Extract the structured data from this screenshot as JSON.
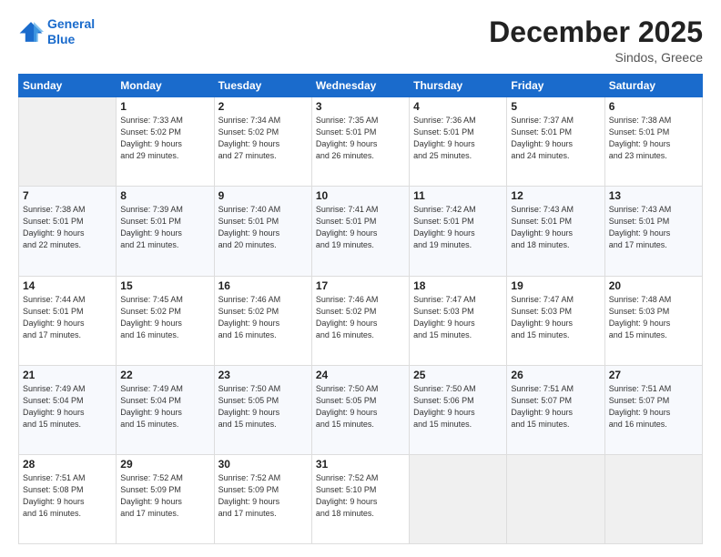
{
  "header": {
    "logo_line1": "General",
    "logo_line2": "Blue",
    "title": "December 2025",
    "subtitle": "Sindos, Greece"
  },
  "weekdays": [
    "Sunday",
    "Monday",
    "Tuesday",
    "Wednesday",
    "Thursday",
    "Friday",
    "Saturday"
  ],
  "weeks": [
    [
      {
        "day": "",
        "info": ""
      },
      {
        "day": "1",
        "info": "Sunrise: 7:33 AM\nSunset: 5:02 PM\nDaylight: 9 hours\nand 29 minutes."
      },
      {
        "day": "2",
        "info": "Sunrise: 7:34 AM\nSunset: 5:02 PM\nDaylight: 9 hours\nand 27 minutes."
      },
      {
        "day": "3",
        "info": "Sunrise: 7:35 AM\nSunset: 5:01 PM\nDaylight: 9 hours\nand 26 minutes."
      },
      {
        "day": "4",
        "info": "Sunrise: 7:36 AM\nSunset: 5:01 PM\nDaylight: 9 hours\nand 25 minutes."
      },
      {
        "day": "5",
        "info": "Sunrise: 7:37 AM\nSunset: 5:01 PM\nDaylight: 9 hours\nand 24 minutes."
      },
      {
        "day": "6",
        "info": "Sunrise: 7:38 AM\nSunset: 5:01 PM\nDaylight: 9 hours\nand 23 minutes."
      }
    ],
    [
      {
        "day": "7",
        "info": "Sunrise: 7:38 AM\nSunset: 5:01 PM\nDaylight: 9 hours\nand 22 minutes."
      },
      {
        "day": "8",
        "info": "Sunrise: 7:39 AM\nSunset: 5:01 PM\nDaylight: 9 hours\nand 21 minutes."
      },
      {
        "day": "9",
        "info": "Sunrise: 7:40 AM\nSunset: 5:01 PM\nDaylight: 9 hours\nand 20 minutes."
      },
      {
        "day": "10",
        "info": "Sunrise: 7:41 AM\nSunset: 5:01 PM\nDaylight: 9 hours\nand 19 minutes."
      },
      {
        "day": "11",
        "info": "Sunrise: 7:42 AM\nSunset: 5:01 PM\nDaylight: 9 hours\nand 19 minutes."
      },
      {
        "day": "12",
        "info": "Sunrise: 7:43 AM\nSunset: 5:01 PM\nDaylight: 9 hours\nand 18 minutes."
      },
      {
        "day": "13",
        "info": "Sunrise: 7:43 AM\nSunset: 5:01 PM\nDaylight: 9 hours\nand 17 minutes."
      }
    ],
    [
      {
        "day": "14",
        "info": "Sunrise: 7:44 AM\nSunset: 5:01 PM\nDaylight: 9 hours\nand 17 minutes."
      },
      {
        "day": "15",
        "info": "Sunrise: 7:45 AM\nSunset: 5:02 PM\nDaylight: 9 hours\nand 16 minutes."
      },
      {
        "day": "16",
        "info": "Sunrise: 7:46 AM\nSunset: 5:02 PM\nDaylight: 9 hours\nand 16 minutes."
      },
      {
        "day": "17",
        "info": "Sunrise: 7:46 AM\nSunset: 5:02 PM\nDaylight: 9 hours\nand 16 minutes."
      },
      {
        "day": "18",
        "info": "Sunrise: 7:47 AM\nSunset: 5:03 PM\nDaylight: 9 hours\nand 15 minutes."
      },
      {
        "day": "19",
        "info": "Sunrise: 7:47 AM\nSunset: 5:03 PM\nDaylight: 9 hours\nand 15 minutes."
      },
      {
        "day": "20",
        "info": "Sunrise: 7:48 AM\nSunset: 5:03 PM\nDaylight: 9 hours\nand 15 minutes."
      }
    ],
    [
      {
        "day": "21",
        "info": "Sunrise: 7:49 AM\nSunset: 5:04 PM\nDaylight: 9 hours\nand 15 minutes."
      },
      {
        "day": "22",
        "info": "Sunrise: 7:49 AM\nSunset: 5:04 PM\nDaylight: 9 hours\nand 15 minutes."
      },
      {
        "day": "23",
        "info": "Sunrise: 7:50 AM\nSunset: 5:05 PM\nDaylight: 9 hours\nand 15 minutes."
      },
      {
        "day": "24",
        "info": "Sunrise: 7:50 AM\nSunset: 5:05 PM\nDaylight: 9 hours\nand 15 minutes."
      },
      {
        "day": "25",
        "info": "Sunrise: 7:50 AM\nSunset: 5:06 PM\nDaylight: 9 hours\nand 15 minutes."
      },
      {
        "day": "26",
        "info": "Sunrise: 7:51 AM\nSunset: 5:07 PM\nDaylight: 9 hours\nand 15 minutes."
      },
      {
        "day": "27",
        "info": "Sunrise: 7:51 AM\nSunset: 5:07 PM\nDaylight: 9 hours\nand 16 minutes."
      }
    ],
    [
      {
        "day": "28",
        "info": "Sunrise: 7:51 AM\nSunset: 5:08 PM\nDaylight: 9 hours\nand 16 minutes."
      },
      {
        "day": "29",
        "info": "Sunrise: 7:52 AM\nSunset: 5:09 PM\nDaylight: 9 hours\nand 17 minutes."
      },
      {
        "day": "30",
        "info": "Sunrise: 7:52 AM\nSunset: 5:09 PM\nDaylight: 9 hours\nand 17 minutes."
      },
      {
        "day": "31",
        "info": "Sunrise: 7:52 AM\nSunset: 5:10 PM\nDaylight: 9 hours\nand 18 minutes."
      },
      {
        "day": "",
        "info": ""
      },
      {
        "day": "",
        "info": ""
      },
      {
        "day": "",
        "info": ""
      }
    ]
  ]
}
